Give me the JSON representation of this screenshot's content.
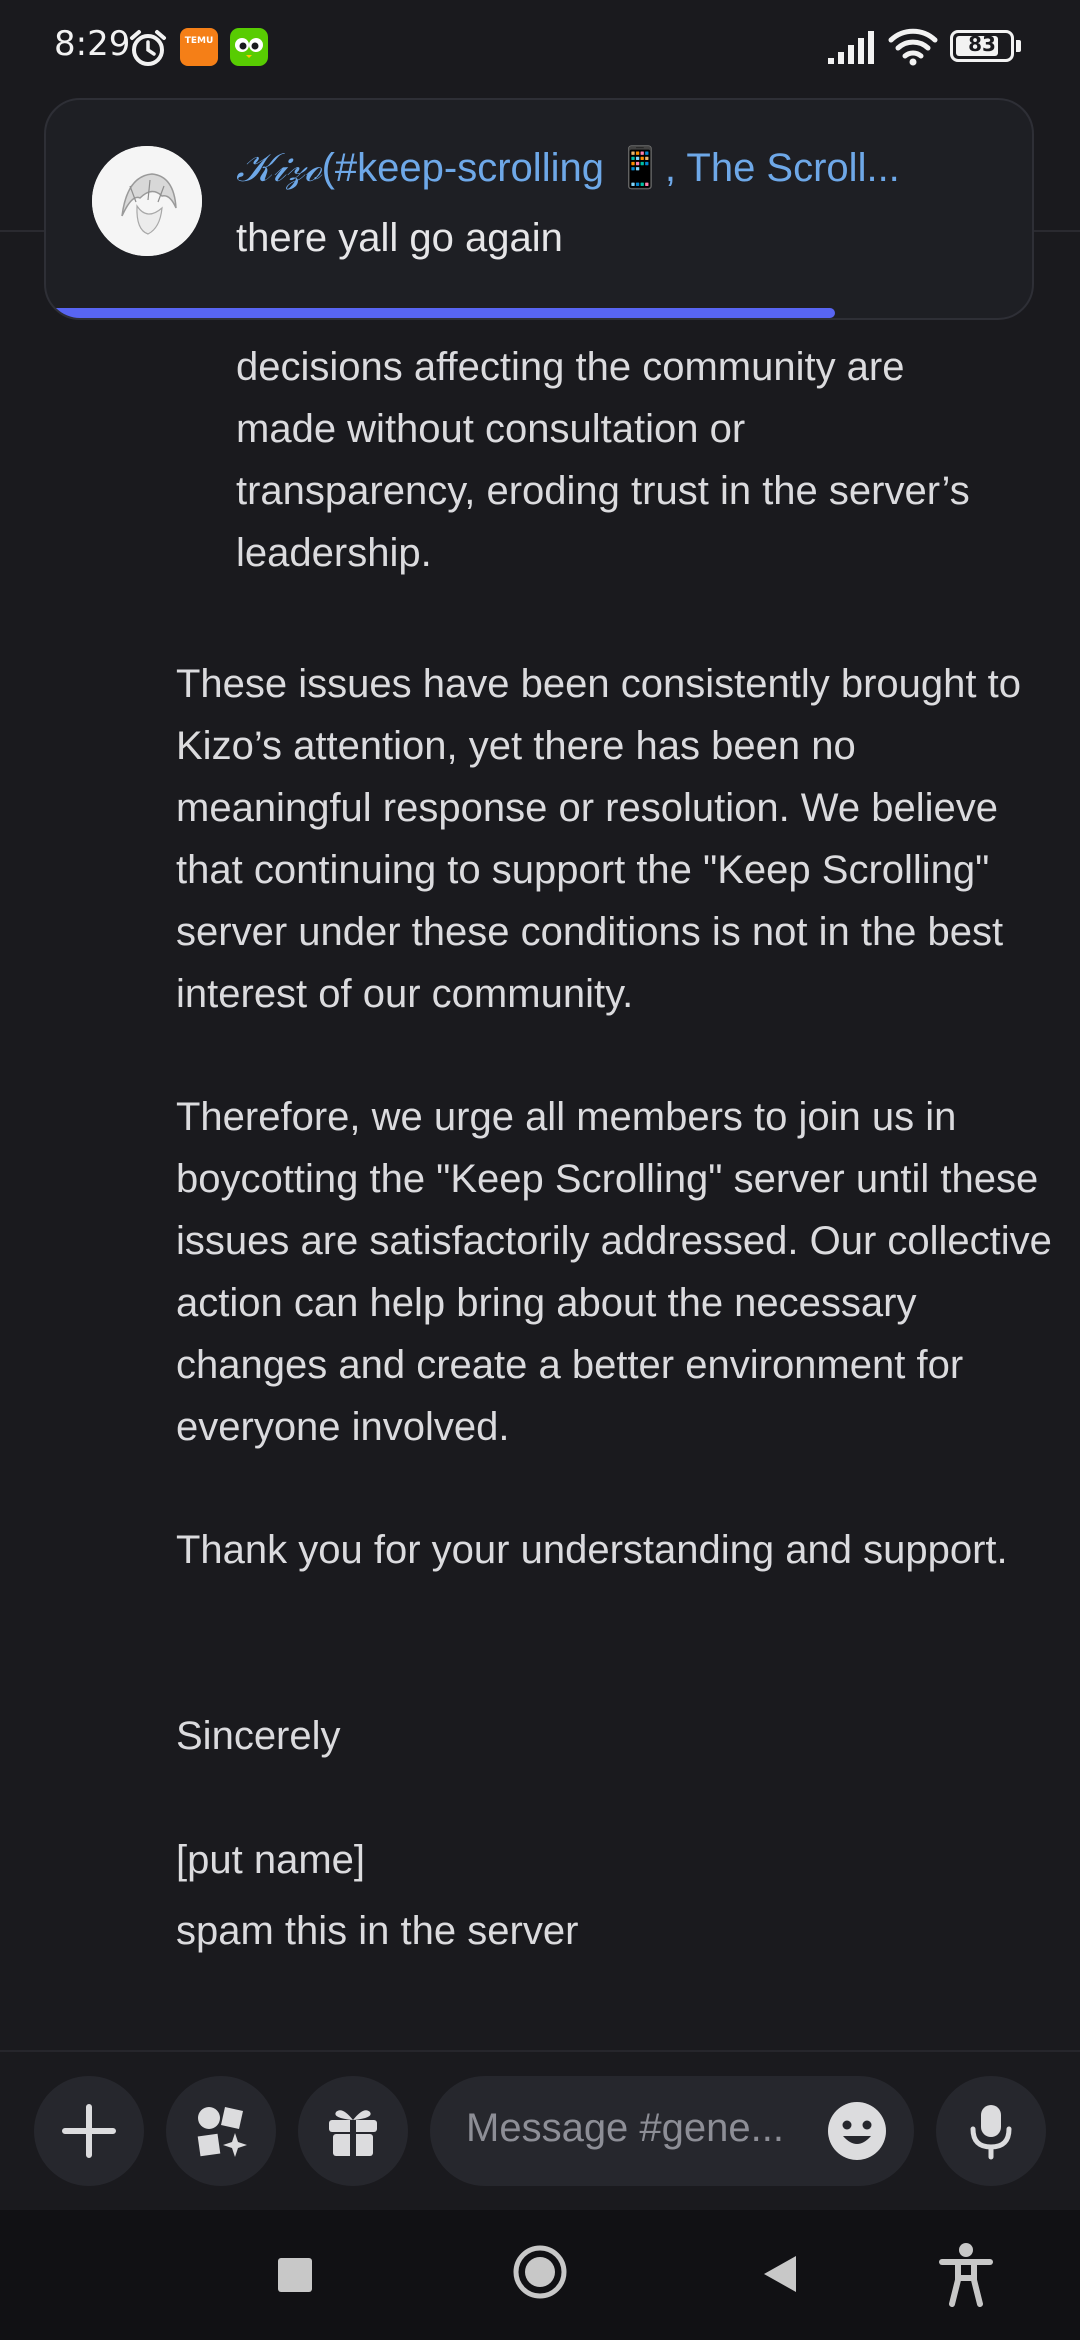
{
  "status_bar": {
    "time": "8:29",
    "battery": "83",
    "battery_percent": 83,
    "temu_label": "TEMU"
  },
  "notification": {
    "title_name": "𝒦𝒾𝓏ℴ",
    "title_channel": "(#keep-scrolling",
    "title_suffix": ", The Scroll...",
    "channel_emoji": "📱",
    "body": "there yall go again",
    "progress_fraction": 0.8
  },
  "message": {
    "bullet_continuation": [
      "decisions affecting the community are",
      "made without consultation or",
      "transparency, eroding trust in the server’s",
      "leadership."
    ],
    "paragraphs": [
      "These issues have been consistently brought to Kizo’s attention, yet there has been no meaningful response or resolution. We believe that continuing to support the \"Keep Scrolling\" server under these conditions is not in the best interest of our community.",
      "Therefore, we urge all members to join us in boycotting the \"Keep Scrolling\" server until these issues are satisfactorily addressed. Our collective action can help bring about the necessary changes and create a better environment for everyone involved.",
      "Thank you for your understanding and support.",
      "Sincerely",
      "[put name]",
      "spam this in the server"
    ]
  },
  "chat_bar": {
    "placeholder": "Message #gene..."
  },
  "colors": {
    "background": "#1a1a1e",
    "accent": "#5865f2",
    "link": "#6ea8e8"
  },
  "icons": [
    "alarm-icon",
    "temu-app-icon",
    "duolingo-app-icon",
    "signal-icon",
    "wifi-icon",
    "battery-icon",
    "plus-icon",
    "apps-icon",
    "gift-icon",
    "emoji-icon",
    "microphone-icon",
    "recent-apps-icon",
    "home-icon",
    "back-icon",
    "accessibility-icon"
  ]
}
